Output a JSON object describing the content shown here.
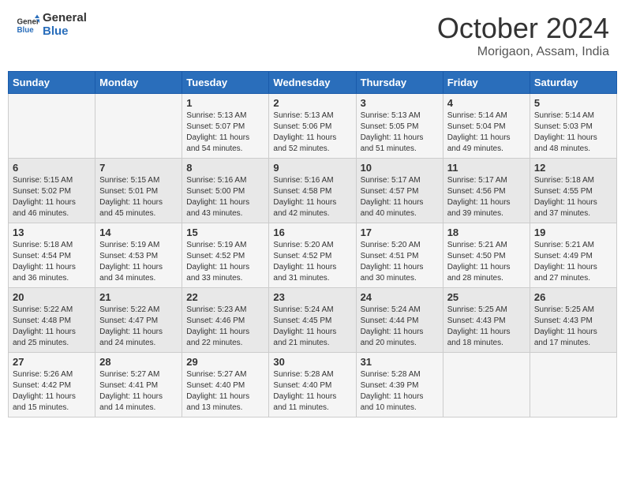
{
  "header": {
    "logo_general": "General",
    "logo_blue": "Blue",
    "month_title": "October 2024",
    "location": "Morigaon, Assam, India"
  },
  "days_of_week": [
    "Sunday",
    "Monday",
    "Tuesday",
    "Wednesday",
    "Thursday",
    "Friday",
    "Saturday"
  ],
  "weeks": [
    [
      {
        "day": "",
        "sunrise": "",
        "sunset": "",
        "daylight": ""
      },
      {
        "day": "",
        "sunrise": "",
        "sunset": "",
        "daylight": ""
      },
      {
        "day": "1",
        "sunrise": "Sunrise: 5:13 AM",
        "sunset": "Sunset: 5:07 PM",
        "daylight": "Daylight: 11 hours and 54 minutes."
      },
      {
        "day": "2",
        "sunrise": "Sunrise: 5:13 AM",
        "sunset": "Sunset: 5:06 PM",
        "daylight": "Daylight: 11 hours and 52 minutes."
      },
      {
        "day": "3",
        "sunrise": "Sunrise: 5:13 AM",
        "sunset": "Sunset: 5:05 PM",
        "daylight": "Daylight: 11 hours and 51 minutes."
      },
      {
        "day": "4",
        "sunrise": "Sunrise: 5:14 AM",
        "sunset": "Sunset: 5:04 PM",
        "daylight": "Daylight: 11 hours and 49 minutes."
      },
      {
        "day": "5",
        "sunrise": "Sunrise: 5:14 AM",
        "sunset": "Sunset: 5:03 PM",
        "daylight": "Daylight: 11 hours and 48 minutes."
      }
    ],
    [
      {
        "day": "6",
        "sunrise": "Sunrise: 5:15 AM",
        "sunset": "Sunset: 5:02 PM",
        "daylight": "Daylight: 11 hours and 46 minutes."
      },
      {
        "day": "7",
        "sunrise": "Sunrise: 5:15 AM",
        "sunset": "Sunset: 5:01 PM",
        "daylight": "Daylight: 11 hours and 45 minutes."
      },
      {
        "day": "8",
        "sunrise": "Sunrise: 5:16 AM",
        "sunset": "Sunset: 5:00 PM",
        "daylight": "Daylight: 11 hours and 43 minutes."
      },
      {
        "day": "9",
        "sunrise": "Sunrise: 5:16 AM",
        "sunset": "Sunset: 4:58 PM",
        "daylight": "Daylight: 11 hours and 42 minutes."
      },
      {
        "day": "10",
        "sunrise": "Sunrise: 5:17 AM",
        "sunset": "Sunset: 4:57 PM",
        "daylight": "Daylight: 11 hours and 40 minutes."
      },
      {
        "day": "11",
        "sunrise": "Sunrise: 5:17 AM",
        "sunset": "Sunset: 4:56 PM",
        "daylight": "Daylight: 11 hours and 39 minutes."
      },
      {
        "day": "12",
        "sunrise": "Sunrise: 5:18 AM",
        "sunset": "Sunset: 4:55 PM",
        "daylight": "Daylight: 11 hours and 37 minutes."
      }
    ],
    [
      {
        "day": "13",
        "sunrise": "Sunrise: 5:18 AM",
        "sunset": "Sunset: 4:54 PM",
        "daylight": "Daylight: 11 hours and 36 minutes."
      },
      {
        "day": "14",
        "sunrise": "Sunrise: 5:19 AM",
        "sunset": "Sunset: 4:53 PM",
        "daylight": "Daylight: 11 hours and 34 minutes."
      },
      {
        "day": "15",
        "sunrise": "Sunrise: 5:19 AM",
        "sunset": "Sunset: 4:52 PM",
        "daylight": "Daylight: 11 hours and 33 minutes."
      },
      {
        "day": "16",
        "sunrise": "Sunrise: 5:20 AM",
        "sunset": "Sunset: 4:52 PM",
        "daylight": "Daylight: 11 hours and 31 minutes."
      },
      {
        "day": "17",
        "sunrise": "Sunrise: 5:20 AM",
        "sunset": "Sunset: 4:51 PM",
        "daylight": "Daylight: 11 hours and 30 minutes."
      },
      {
        "day": "18",
        "sunrise": "Sunrise: 5:21 AM",
        "sunset": "Sunset: 4:50 PM",
        "daylight": "Daylight: 11 hours and 28 minutes."
      },
      {
        "day": "19",
        "sunrise": "Sunrise: 5:21 AM",
        "sunset": "Sunset: 4:49 PM",
        "daylight": "Daylight: 11 hours and 27 minutes."
      }
    ],
    [
      {
        "day": "20",
        "sunrise": "Sunrise: 5:22 AM",
        "sunset": "Sunset: 4:48 PM",
        "daylight": "Daylight: 11 hours and 25 minutes."
      },
      {
        "day": "21",
        "sunrise": "Sunrise: 5:22 AM",
        "sunset": "Sunset: 4:47 PM",
        "daylight": "Daylight: 11 hours and 24 minutes."
      },
      {
        "day": "22",
        "sunrise": "Sunrise: 5:23 AM",
        "sunset": "Sunset: 4:46 PM",
        "daylight": "Daylight: 11 hours and 22 minutes."
      },
      {
        "day": "23",
        "sunrise": "Sunrise: 5:24 AM",
        "sunset": "Sunset: 4:45 PM",
        "daylight": "Daylight: 11 hours and 21 minutes."
      },
      {
        "day": "24",
        "sunrise": "Sunrise: 5:24 AM",
        "sunset": "Sunset: 4:44 PM",
        "daylight": "Daylight: 11 hours and 20 minutes."
      },
      {
        "day": "25",
        "sunrise": "Sunrise: 5:25 AM",
        "sunset": "Sunset: 4:43 PM",
        "daylight": "Daylight: 11 hours and 18 minutes."
      },
      {
        "day": "26",
        "sunrise": "Sunrise: 5:25 AM",
        "sunset": "Sunset: 4:43 PM",
        "daylight": "Daylight: 11 hours and 17 minutes."
      }
    ],
    [
      {
        "day": "27",
        "sunrise": "Sunrise: 5:26 AM",
        "sunset": "Sunset: 4:42 PM",
        "daylight": "Daylight: 11 hours and 15 minutes."
      },
      {
        "day": "28",
        "sunrise": "Sunrise: 5:27 AM",
        "sunset": "Sunset: 4:41 PM",
        "daylight": "Daylight: 11 hours and 14 minutes."
      },
      {
        "day": "29",
        "sunrise": "Sunrise: 5:27 AM",
        "sunset": "Sunset: 4:40 PM",
        "daylight": "Daylight: 11 hours and 13 minutes."
      },
      {
        "day": "30",
        "sunrise": "Sunrise: 5:28 AM",
        "sunset": "Sunset: 4:40 PM",
        "daylight": "Daylight: 11 hours and 11 minutes."
      },
      {
        "day": "31",
        "sunrise": "Sunrise: 5:28 AM",
        "sunset": "Sunset: 4:39 PM",
        "daylight": "Daylight: 11 hours and 10 minutes."
      },
      {
        "day": "",
        "sunrise": "",
        "sunset": "",
        "daylight": ""
      },
      {
        "day": "",
        "sunrise": "",
        "sunset": "",
        "daylight": ""
      }
    ]
  ]
}
